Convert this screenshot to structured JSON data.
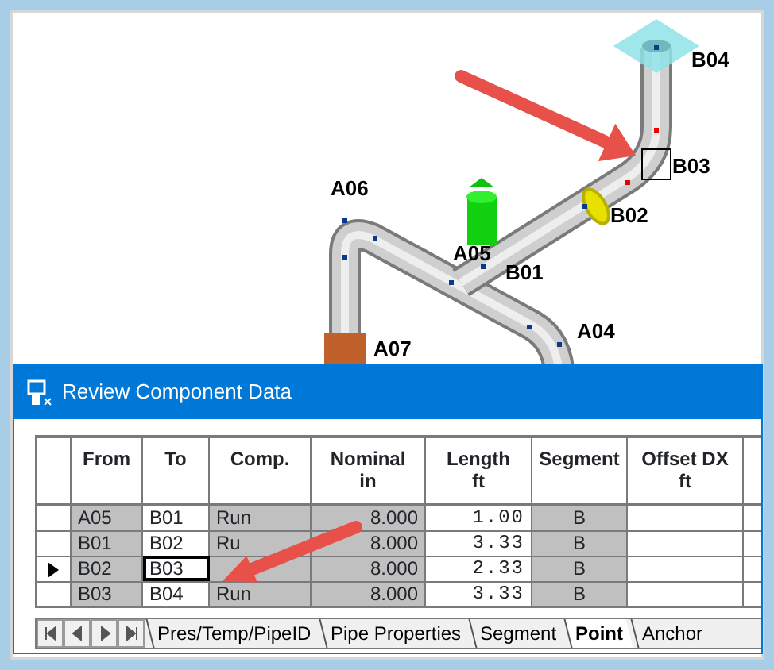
{
  "viewport": {
    "labels": [
      {
        "text": "B04"
      },
      {
        "text": "B03"
      },
      {
        "text": "B02"
      },
      {
        "text": "A06"
      },
      {
        "text": "A05"
      },
      {
        "text": "B01"
      },
      {
        "text": "A04"
      },
      {
        "text": "A07"
      }
    ]
  },
  "dialog": {
    "title": "Review Component Data",
    "columns": [
      {
        "label": "From",
        "editable": false
      },
      {
        "label": "To",
        "editable": true
      },
      {
        "label": "Comp.",
        "editable": false
      },
      {
        "label": "Nominal",
        "unit": "in",
        "editable": false
      },
      {
        "label": "Length",
        "unit": "ft",
        "editable": true
      },
      {
        "label": "Segment",
        "editable": false
      },
      {
        "label": "Offset DX",
        "unit": "ft",
        "editable": true
      }
    ],
    "rows": [
      {
        "selected": false,
        "cells": [
          {
            "text": "A05",
            "focused": false
          },
          {
            "text": "B01",
            "focused": false
          },
          {
            "text": "Run",
            "focused": false
          },
          {
            "text": "8.000",
            "focused": false
          },
          {
            "text": "1.00",
            "focused": false
          },
          {
            "text": "B",
            "focused": false
          }
        ]
      },
      {
        "selected": false,
        "cells": [
          {
            "text": "B01",
            "focused": false
          },
          {
            "text": "B02",
            "focused": false
          },
          {
            "text": "Ru",
            "focused": false
          },
          {
            "text": "8.000",
            "focused": false
          },
          {
            "text": "3.33",
            "focused": false
          },
          {
            "text": "B",
            "focused": false
          }
        ]
      },
      {
        "selected": true,
        "cells": [
          {
            "text": "B02",
            "focused": false
          },
          {
            "text": "B03",
            "focused": true
          },
          {
            "focused": false
          },
          {
            "text": "8.000",
            "focused": false
          },
          {
            "text": "2.33",
            "focused": false
          },
          {
            "text": "B",
            "focused": false
          }
        ]
      },
      {
        "selected": false,
        "cells": [
          {
            "text": "B03",
            "focused": false
          },
          {
            "text": "B04",
            "focused": false
          },
          {
            "text": "Run",
            "focused": false
          },
          {
            "text": "8.000",
            "focused": false
          },
          {
            "text": "3.33",
            "focused": false
          },
          {
            "text": "B",
            "focused": false
          }
        ]
      }
    ],
    "tabs": [
      {
        "label": "Pres/Temp/PipeID",
        "selected": false
      },
      {
        "label": "Pipe Properties",
        "selected": false
      },
      {
        "label": "Segment",
        "selected": false
      },
      {
        "label": "Point",
        "selected": true
      },
      {
        "label": "Anchor",
        "selected": false
      }
    ]
  }
}
